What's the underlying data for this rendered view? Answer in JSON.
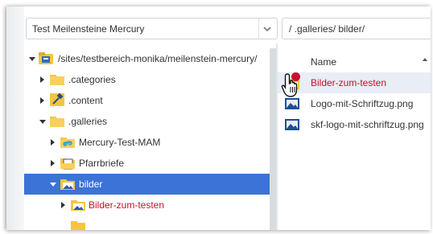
{
  "site_selector": {
    "value": "Test Meilensteine Mercury"
  },
  "path_field": {
    "value": "/ .galleries/ bilder/"
  },
  "tree": {
    "items": [
      {
        "label": "/sites/testbereich-monika/meilenstein-mercury/",
        "icon": "site-root-icon",
        "expanded": true
      },
      {
        "label": ".categories",
        "icon": "folder-icon",
        "expanded": false
      },
      {
        "label": ".content",
        "icon": "content-tools-icon",
        "expanded": false
      },
      {
        "label": ".galleries",
        "icon": "folder-icon",
        "expanded": true
      },
      {
        "label": "Mercury-Test-MAM",
        "icon": "gallery-link-icon",
        "expanded": false
      },
      {
        "label": "Pfarrbriefe",
        "icon": "download-folder-icon",
        "expanded": false
      },
      {
        "label": "bilder",
        "icon": "image-folder-icon",
        "expanded": true,
        "selected": true
      },
      {
        "label": "Bilder-zum-testen",
        "icon": "image-folder-icon",
        "expanded": false,
        "highlight": true
      }
    ]
  },
  "list": {
    "header": "Name",
    "items": [
      {
        "label": "Bilder-zum-testen",
        "icon": "image-folder-icon",
        "highlight": true
      },
      {
        "label": "Logo-mit-Schriftzug.png",
        "icon": "image-file-icon"
      },
      {
        "label": "skf-logo-mit-schriftzug.png",
        "icon": "image-file-icon"
      }
    ]
  },
  "colors": {
    "selected": "#3b73d6",
    "accent_red": "#c8102e",
    "folder": "#f5c542"
  }
}
